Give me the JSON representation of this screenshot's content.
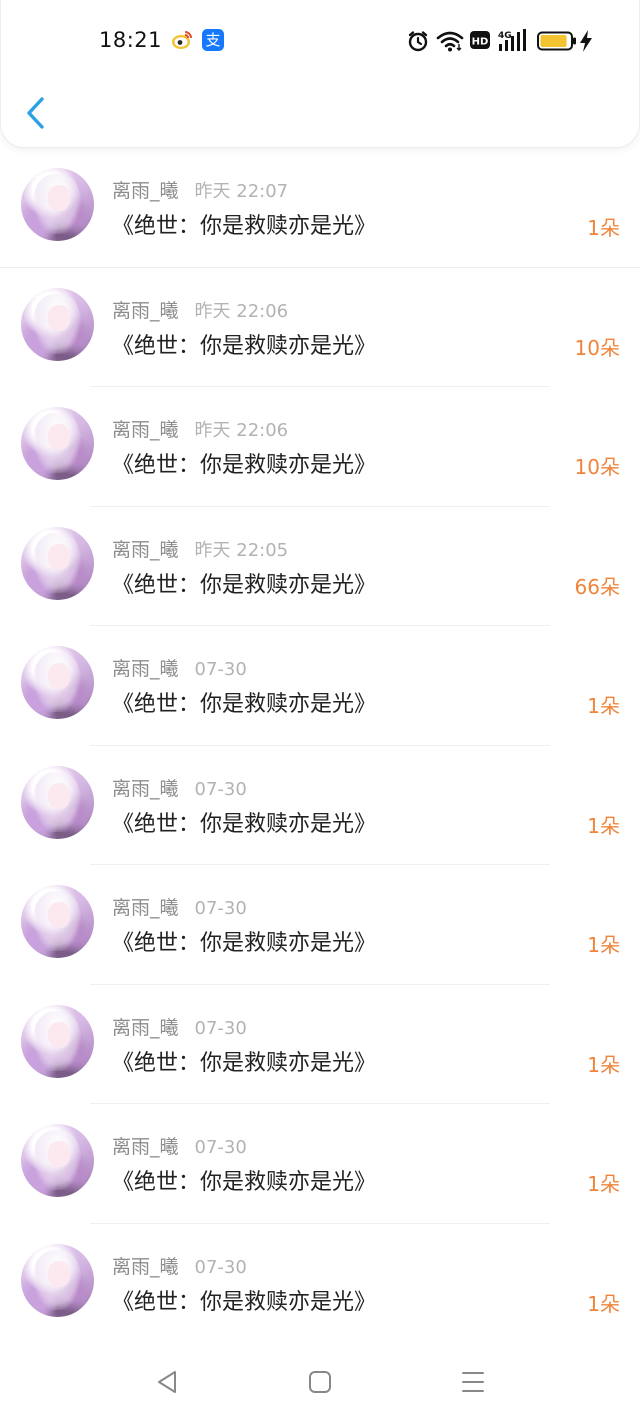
{
  "status_bar": {
    "time": "18:21",
    "apps": [
      "weibo-icon",
      "alipay-icon"
    ],
    "alipay_glyph": "支",
    "network": "4G",
    "hd_label": "HD",
    "battery_level": 0.9,
    "charging": true
  },
  "nav": {
    "back_icon": "chevron-left-icon",
    "accent": "#2aa1e5"
  },
  "colors": {
    "amount": "#f0843a",
    "title": "#222222",
    "meta": "#8c8c8c"
  },
  "items": [
    {
      "user": "离雨_曦",
      "time": "昨天 22:07",
      "title": "《绝世：你是救赎亦是光》",
      "amount": "1朵"
    },
    {
      "user": "离雨_曦",
      "time": "昨天 22:06",
      "title": "《绝世：你是救赎亦是光》",
      "amount": "10朵"
    },
    {
      "user": "离雨_曦",
      "time": "昨天 22:06",
      "title": "《绝世：你是救赎亦是光》",
      "amount": "10朵"
    },
    {
      "user": "离雨_曦",
      "time": "昨天 22:05",
      "title": "《绝世：你是救赎亦是光》",
      "amount": "66朵"
    },
    {
      "user": "离雨_曦",
      "time": "07-30",
      "title": "《绝世：你是救赎亦是光》",
      "amount": "1朵"
    },
    {
      "user": "离雨_曦",
      "time": "07-30",
      "title": "《绝世：你是救赎亦是光》",
      "amount": "1朵"
    },
    {
      "user": "离雨_曦",
      "time": "07-30",
      "title": "《绝世：你是救赎亦是光》",
      "amount": "1朵"
    },
    {
      "user": "离雨_曦",
      "time": "07-30",
      "title": "《绝世：你是救赎亦是光》",
      "amount": "1朵"
    },
    {
      "user": "离雨_曦",
      "time": "07-30",
      "title": "《绝世：你是救赎亦是光》",
      "amount": "1朵"
    },
    {
      "user": "离雨_曦",
      "time": "07-30",
      "title": "《绝世：你是救赎亦是光》",
      "amount": "1朵"
    }
  ],
  "system_nav": {
    "buttons": [
      "back-triangle-icon",
      "home-square-icon",
      "menu-lines-icon"
    ]
  }
}
